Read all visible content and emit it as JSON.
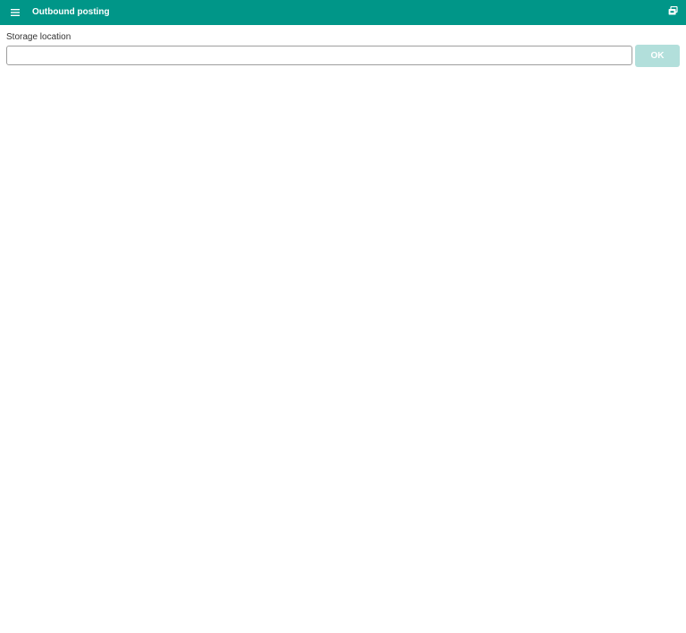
{
  "app_bar": {
    "title": "Outbound posting",
    "background_color": "#009688",
    "menu_icon": "menu-icon",
    "action_icon": "print-queue-icon"
  },
  "form": {
    "storage_location": {
      "label": "Storage location",
      "value": "",
      "placeholder": ""
    },
    "ok_button": {
      "label": "OK",
      "disabled": true,
      "color": "#b2dfdb"
    }
  }
}
